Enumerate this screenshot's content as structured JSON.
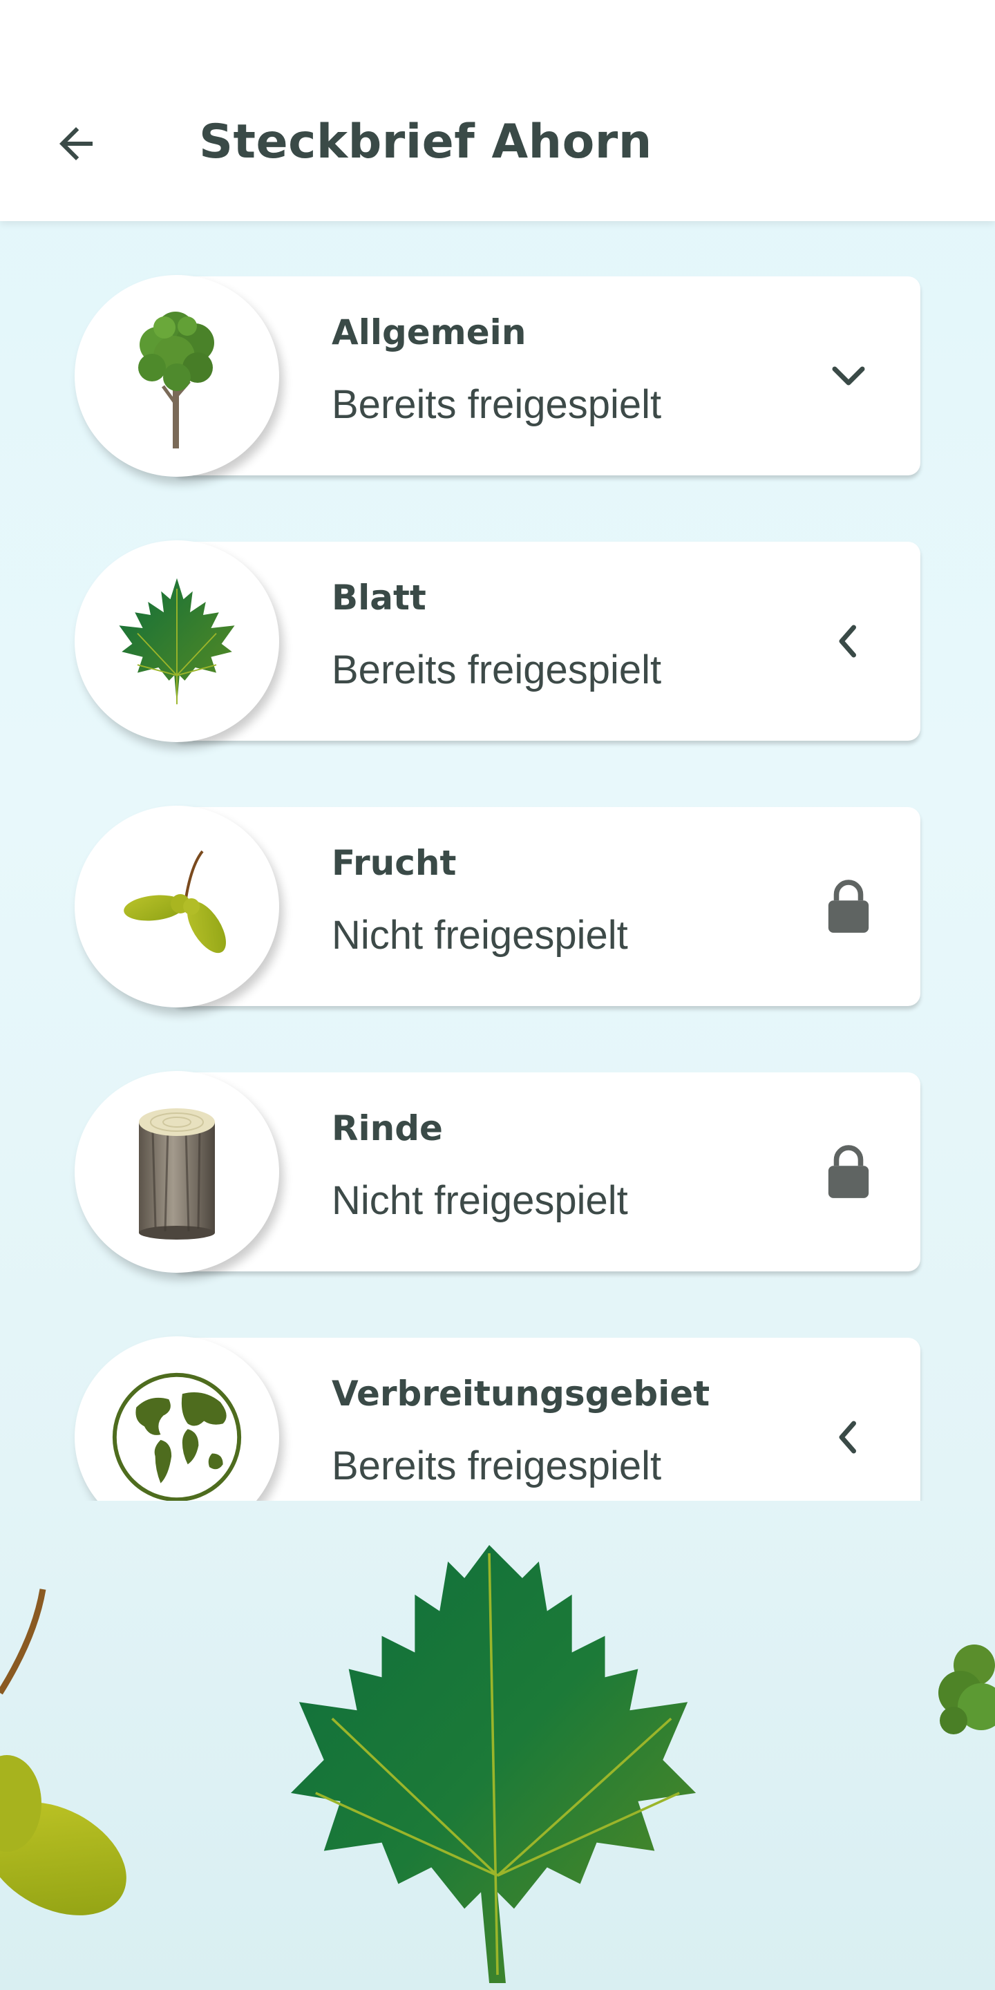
{
  "header": {
    "title": "Steckbrief Ahorn",
    "back_icon": "arrow-back-icon"
  },
  "items": [
    {
      "name": "allgemein",
      "title": "Allgemein",
      "status": "Bereits freigespielt",
      "trailing_icon": "chevron-down-icon",
      "image": "tree-icon"
    },
    {
      "name": "blatt",
      "title": "Blatt",
      "status": "Bereits freigespielt",
      "trailing_icon": "chevron-left-icon",
      "image": "maple-leaf-icon"
    },
    {
      "name": "frucht",
      "title": "Frucht",
      "status": "Nicht freigespielt",
      "trailing_icon": "lock-icon",
      "image": "maple-seed-icon"
    },
    {
      "name": "rinde",
      "title": "Rinde",
      "status": "Nicht freigespielt",
      "trailing_icon": "lock-icon",
      "image": "bark-log-icon"
    },
    {
      "name": "verbreitungsgebiet",
      "title": "Verbreitungsgebiet",
      "status": "Bereits freigespielt",
      "trailing_icon": "chevron-left-icon",
      "image": "globe-icon"
    }
  ],
  "colors": {
    "text": "#3a4a47",
    "icon": "#5f6462",
    "leaf_dark": "#0f6e3b",
    "leaf_light": "#5a8c22",
    "seed": "#a8b31c"
  }
}
